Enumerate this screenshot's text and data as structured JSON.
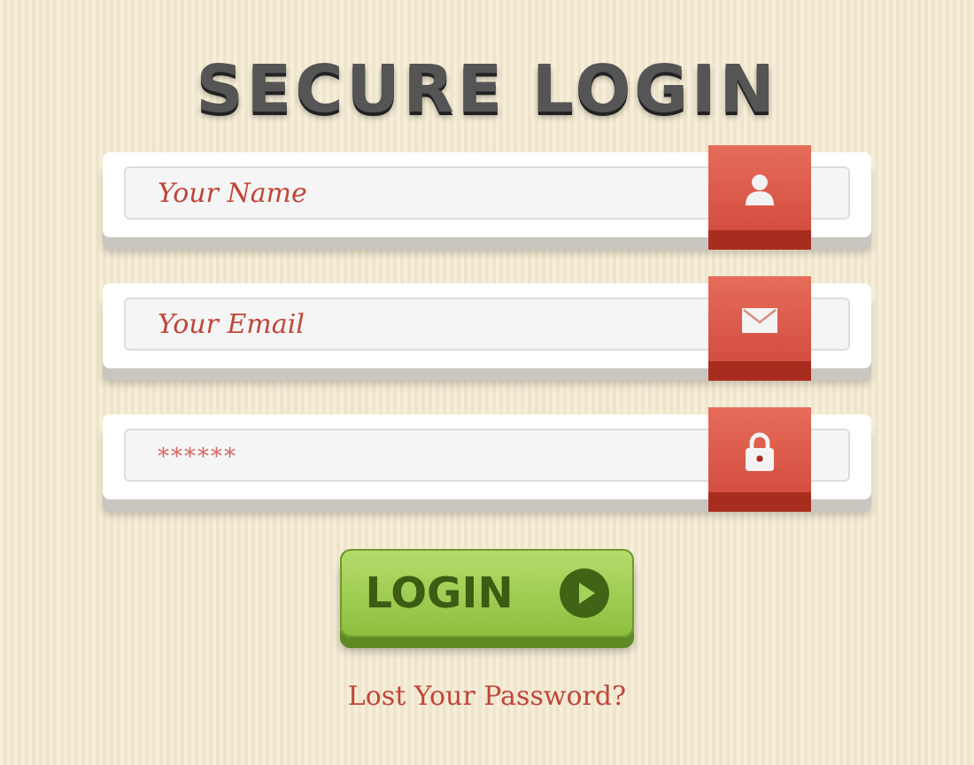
{
  "title": "SECURE LOGIN",
  "fields": [
    {
      "kind": "user",
      "placeholder": "Your Name"
    },
    {
      "kind": "email",
      "placeholder": "Your Email"
    },
    {
      "kind": "password",
      "placeholder": "******"
    }
  ],
  "login_button": {
    "label": "LOGIN"
  },
  "forgot_link": "Lost Your Password?"
}
